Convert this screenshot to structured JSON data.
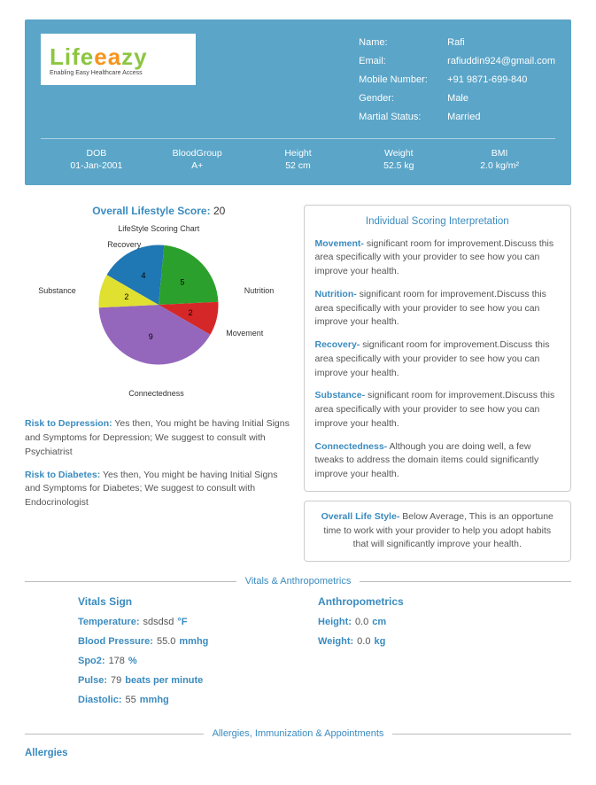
{
  "logo": {
    "part1": "Life",
    "part2": "ea",
    "part3": "zy",
    "tagline": "Enabling Easy Healthcare Access"
  },
  "profile": {
    "labels": {
      "name": "Name:",
      "email": "Email:",
      "mobile": "Mobile Number:",
      "gender": "Gender:",
      "martial": "Martial Status:"
    },
    "name": "Rafi",
    "email": "rafiuddin924@gmail.com",
    "mobile": "+91 9871-699-840",
    "gender": "Male",
    "martial": "Married"
  },
  "stats": {
    "dob": {
      "label": "DOB",
      "value": "01-Jan-2001"
    },
    "blood": {
      "label": "BloodGroup",
      "value": "A+"
    },
    "height": {
      "label": "Height",
      "value": "52 cm"
    },
    "weight": {
      "label": "Weight",
      "value": "52.5 kg"
    },
    "bmi": {
      "label": "BMI",
      "value": "2.0 kg/m²"
    }
  },
  "score": {
    "label": "Overall Lifestyle Score:",
    "value": "20"
  },
  "chart_data": {
    "type": "pie",
    "title": "LifeStyle Scoring Chart",
    "categories": [
      "Recovery",
      "Nutrition",
      "Movement",
      "Connectedness",
      "Substance"
    ],
    "values": [
      4,
      5,
      2,
      9,
      2
    ],
    "colors": [
      "#1f77b4",
      "#2ca02c",
      "#d62728",
      "#9467bd",
      "#e0e030"
    ]
  },
  "interpretation": {
    "title": "Individual Scoring Interpretation",
    "items": {
      "movement": {
        "label": "Movement-",
        "text": "significant room for improvement.Discuss this area specifically with your provider to see how you can improve your health."
      },
      "nutrition": {
        "label": "Nutrition-",
        "text": "significant room for improvement.Discuss this area specifically with your provider to see how you can improve your health."
      },
      "recovery": {
        "label": "Recovery-",
        "text": "significant room for improvement.Discuss this area specifically with your provider to see how you can improve your health."
      },
      "substance": {
        "label": "Substance-",
        "text": "significant room for improvement.Discuss this area specifically with your provider to see how you can improve your health."
      },
      "connectedness": {
        "label": "Connectedness-",
        "text": "Although you are doing well, a few tweaks to address the domain items could significantly improve your health."
      }
    },
    "overall": {
      "label": "Overall Life Style-",
      "text": "Below Average, This is an opportune time to work with your provider to help you adopt habits that will significantly improve your health."
    }
  },
  "risks": {
    "depression": {
      "label": "Risk to Depression:",
      "text": "Yes then, You might be having Initial Signs and Symptoms for Depression; We suggest to consult with Psychiatrist"
    },
    "diabetes": {
      "label": "Risk to Diabetes:",
      "text": "Yes then, You might be having Initial Signs and Symptoms for Diabetes; We suggest to consult with Endocrinologist"
    }
  },
  "sections": {
    "vitals": "Vitals & Anthropometrics",
    "allergies": "Allergies, Immunization & Appointments"
  },
  "vitals": {
    "heading": "Vitals Sign",
    "temperature": {
      "label": "Temperature:",
      "value": "sdsdsd",
      "unit": "°F"
    },
    "bp": {
      "label": "Blood Pressure:",
      "value": "55.0",
      "unit": "mmhg"
    },
    "spo2": {
      "label": "Spo2:",
      "value": "178",
      "unit": "%"
    },
    "pulse": {
      "label": "Pulse:",
      "value": "79",
      "unit": "beats per minute"
    },
    "diastolic": {
      "label": "Diastolic:",
      "value": "55",
      "unit": "mmhg"
    }
  },
  "anthro": {
    "heading": "Anthropometrics",
    "height": {
      "label": "Height:",
      "value": "0.0",
      "unit": "cm"
    },
    "weight": {
      "label": "Weight:",
      "value": "0.0",
      "unit": "kg"
    }
  },
  "allergies_heading": "Allergies"
}
